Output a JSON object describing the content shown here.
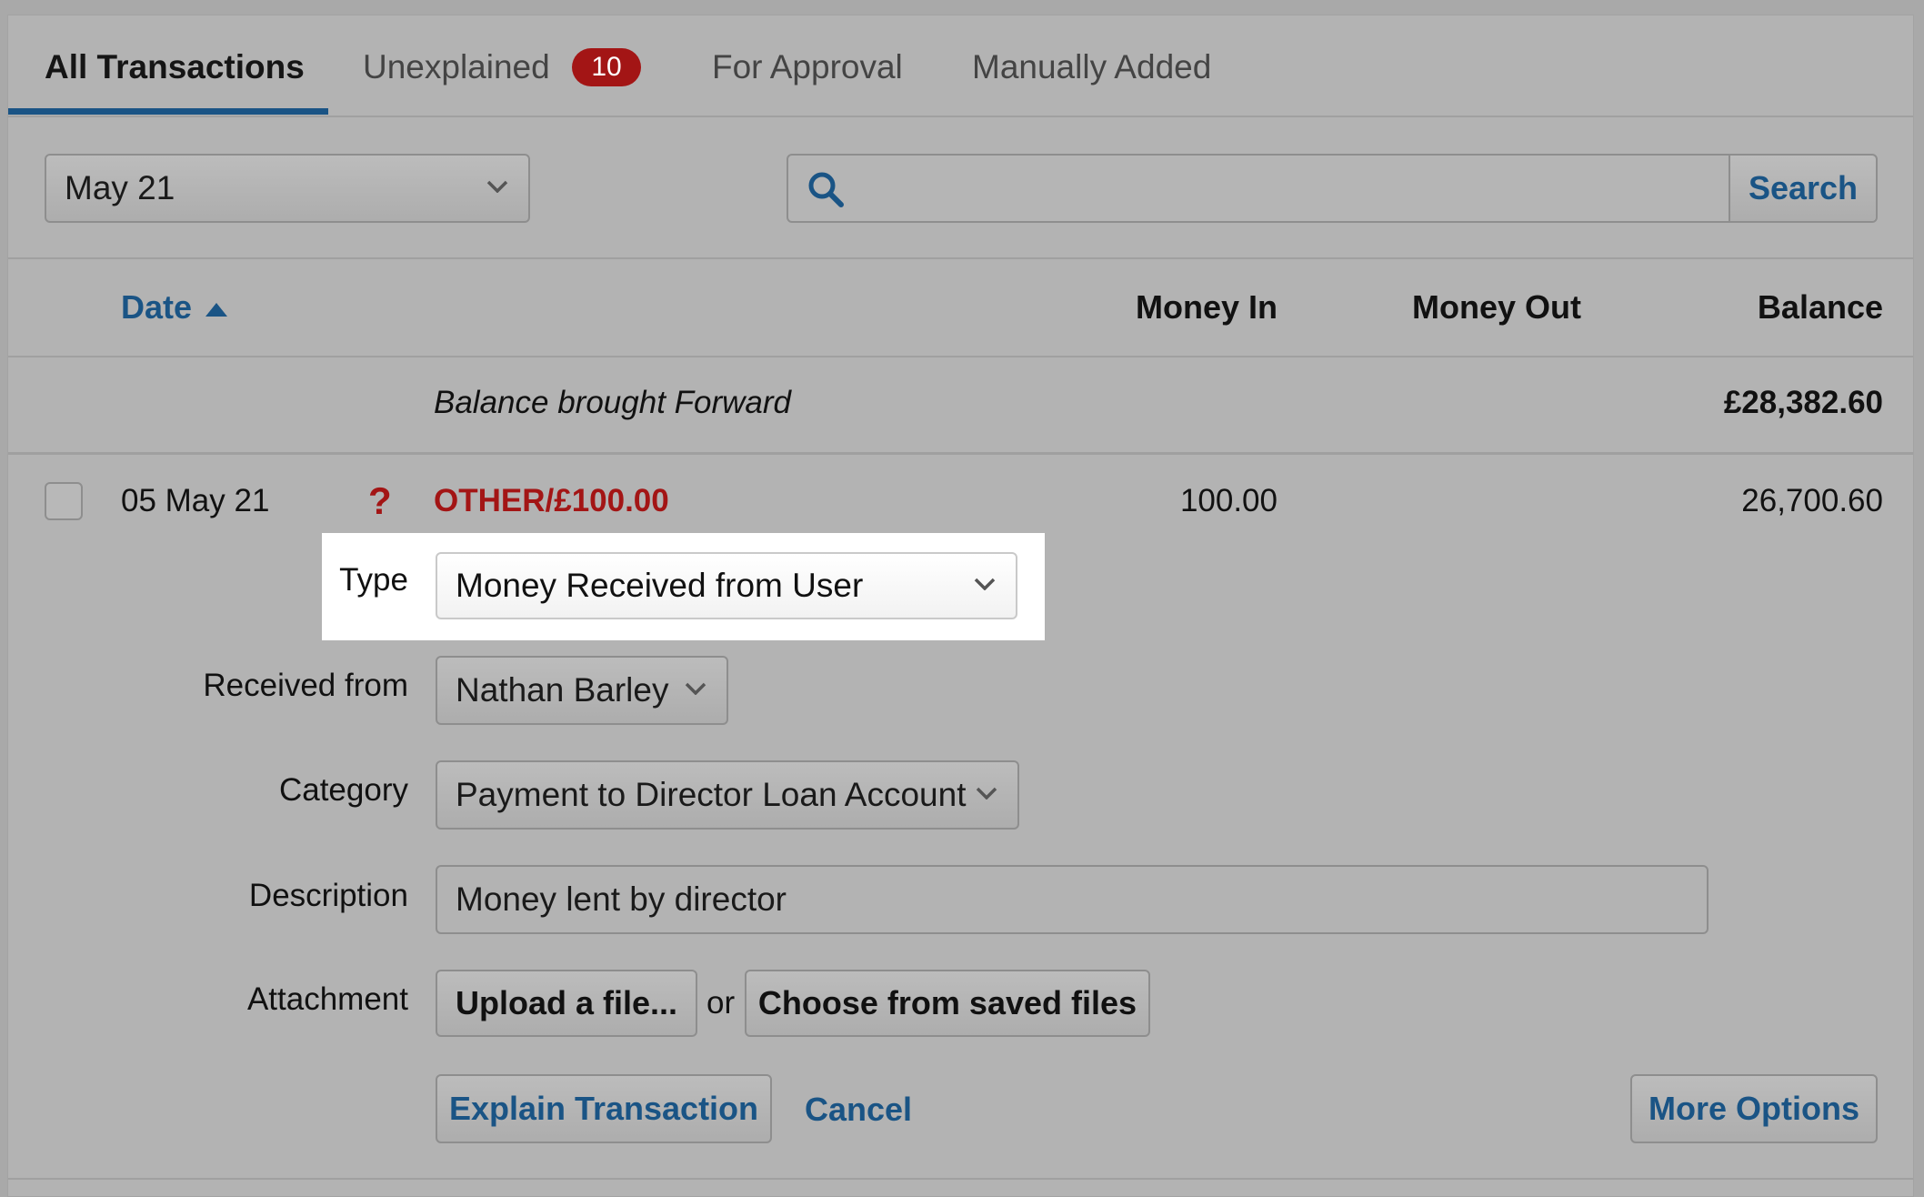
{
  "tabs": [
    {
      "label": "All Transactions"
    },
    {
      "label": "Unexplained",
      "badge": "10"
    },
    {
      "label": "For Approval"
    },
    {
      "label": "Manually Added"
    }
  ],
  "filter": {
    "period": "May 21",
    "search_placeholder": "",
    "search_button": "Search"
  },
  "columns": {
    "date": "Date",
    "money_in": "Money In",
    "money_out": "Money Out",
    "balance": "Balance"
  },
  "balance_forward": {
    "label": "Balance brought Forward",
    "amount": "£28,382.60"
  },
  "transaction": {
    "date": "05 May 21",
    "status_icon": "?",
    "description": "OTHER/£100.00",
    "money_in": "100.00",
    "balance": "26,700.60"
  },
  "form": {
    "type_label": "Type",
    "type_value": "Money Received from User",
    "received_from_label": "Received from",
    "received_from_value": "Nathan Barley",
    "category_label": "Category",
    "category_value": "Payment to Director Loan Account",
    "description_label": "Description",
    "description_value": "Money lent by director",
    "attachment_label": "Attachment",
    "upload_button": "Upload a file...",
    "or_text": "or",
    "saved_files_button": "Choose from saved files",
    "explain_button": "Explain Transaction",
    "cancel_link": "Cancel",
    "more_options_button": "More Options"
  },
  "colors": {
    "accent": "#1a5485",
    "badge": "#a31515",
    "error_text": "#a31515"
  }
}
